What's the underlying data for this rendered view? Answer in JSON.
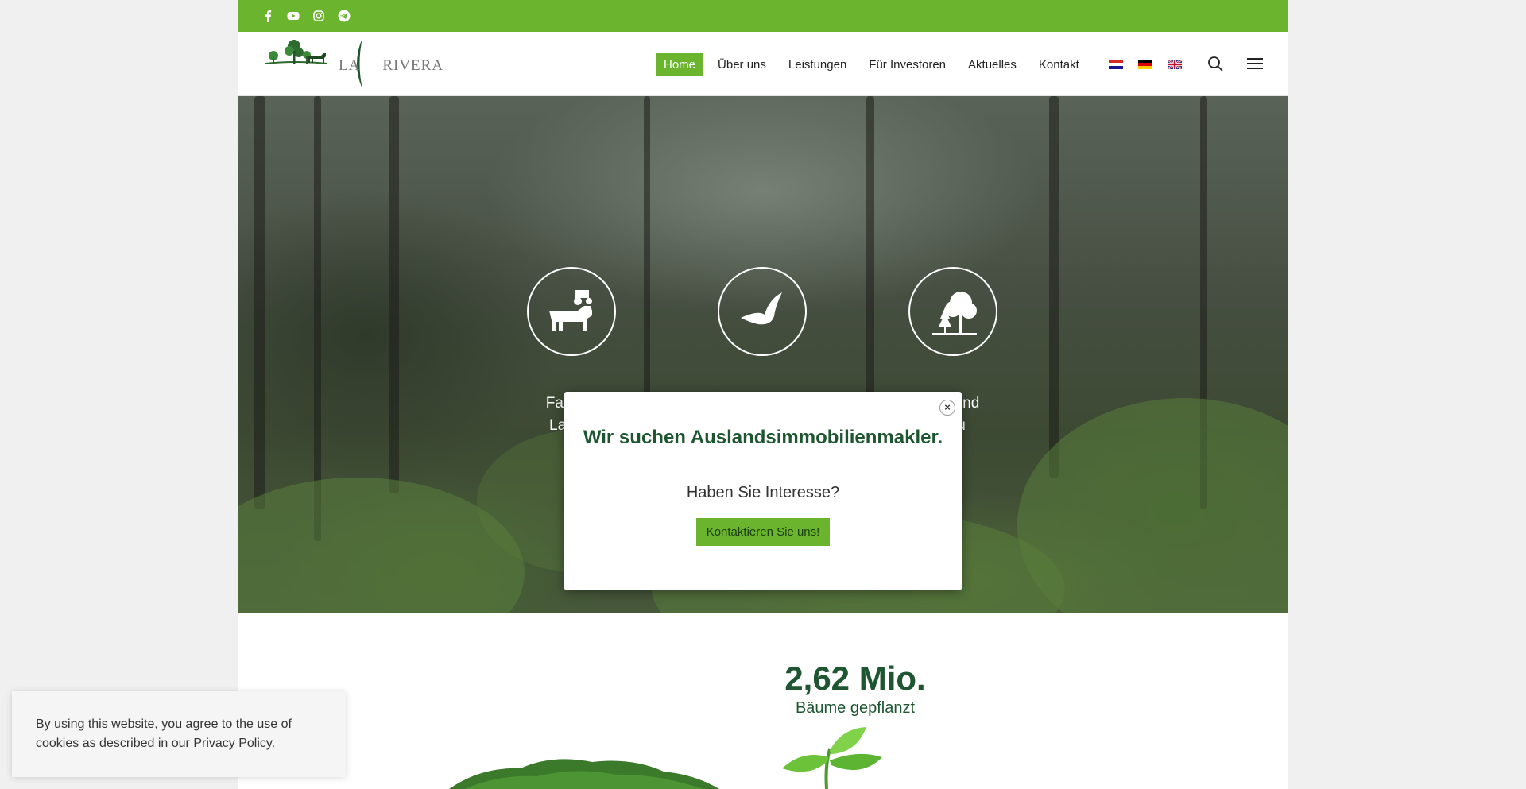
{
  "social": {
    "items": [
      {
        "name": "facebook"
      },
      {
        "name": "youtube"
      },
      {
        "name": "instagram"
      },
      {
        "name": "telegram"
      }
    ]
  },
  "brand": {
    "part1": "LA",
    "part2": "RIVERA"
  },
  "nav": {
    "items": [
      "Home",
      "Über uns",
      "Leistungen",
      "Für Investoren",
      "Aktuelles",
      "Kontakt"
    ],
    "active_index": 0
  },
  "languages": [
    "hr",
    "de",
    "en"
  ],
  "hero": {
    "services": [
      {
        "icon": "cow-tractor-icon",
        "label_line1": "Farmko",
        "label_line2": "Landw"
      },
      {
        "icon": "bird-icon",
        "label_line1": "",
        "label_line2": ""
      },
      {
        "icon": "trees-icon",
        "label_line1": "cke und",
        "label_line2": "bau"
      }
    ]
  },
  "modal": {
    "close_glyph": "×",
    "title": "Wir suchen Auslandsimmobilienmakler.",
    "subtitle": "Haben Sie Interesse?",
    "button": "Kontaktieren Sie uns!"
  },
  "stats": {
    "number": "2,62 Mio.",
    "label": "Bäume gepflanzt"
  },
  "cookie": {
    "text": "By using this website, you agree to the use of cookies as described in our Privacy Policy."
  },
  "colors": {
    "accent": "#6ab42e",
    "brand_dark": "#1e5631"
  }
}
